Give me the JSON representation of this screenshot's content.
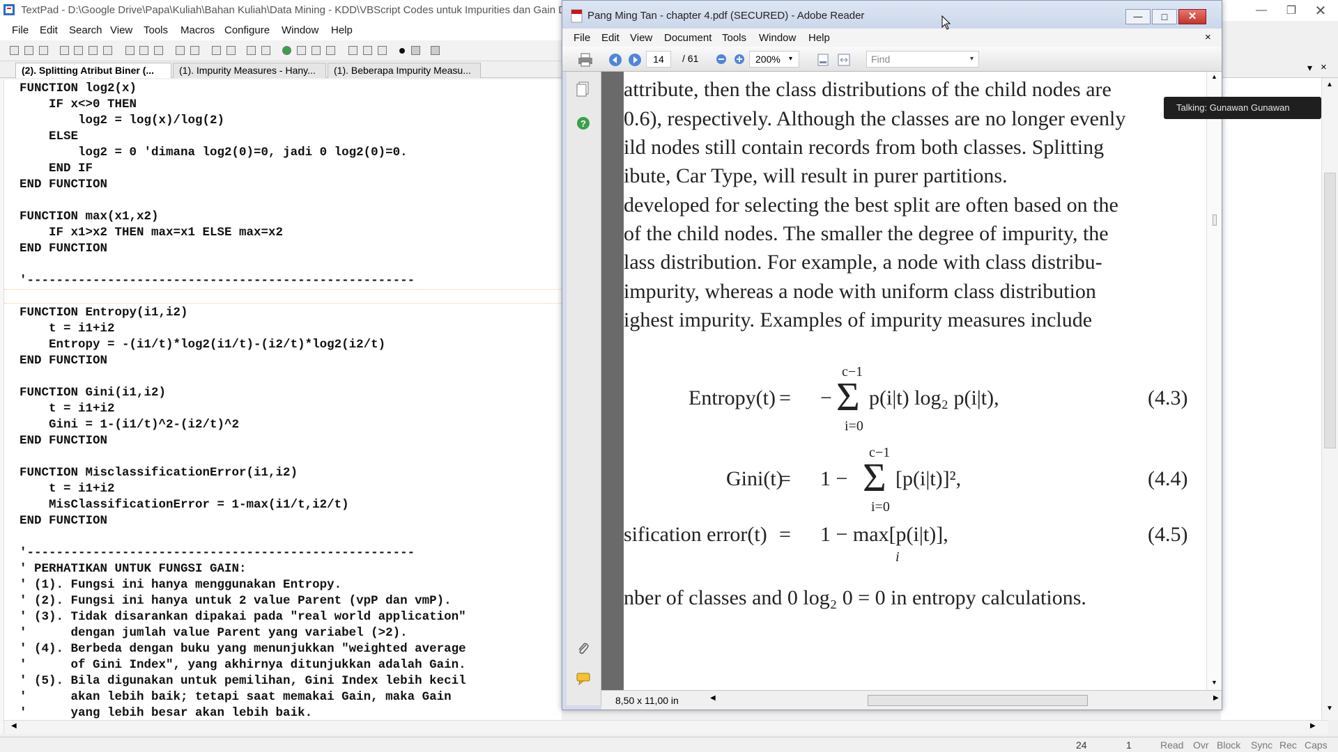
{
  "textpad": {
    "title": "TextPad - D:\\Google Drive\\Papa\\Kuliah\\Bahan Kuliah\\Data Mining - KDD\\VBScript Codes untuk Impurities dan Gain D",
    "menu": [
      "File",
      "Edit",
      "Search",
      "View",
      "Tools",
      "Macros",
      "Configure",
      "Window",
      "Help"
    ],
    "tabs": [
      "(2). Splitting Atribut Biner (...",
      "(1). Impurity Measures  - Hany...",
      "(1). Beberapa Impurity Measu..."
    ],
    "code_lines": [
      "FUNCTION log2(x)",
      "    IF x<>0 THEN",
      "        log2 = log(x)/log(2)",
      "    ELSE",
      "        log2 = 0 'dimana log2(0)=0, jadi 0 log2(0)=0.",
      "    END IF",
      "END FUNCTION",
      "",
      "FUNCTION max(x1,x2)",
      "    IF x1>x2 THEN max=x1 ELSE max=x2",
      "END FUNCTION",
      "",
      "'-----------------------------------------------------",
      "",
      "FUNCTION Entropy(i1,i2)",
      "    t = i1+i2",
      "    Entropy = -(i1/t)*log2(i1/t)-(i2/t)*log2(i2/t)",
      "END FUNCTION",
      "",
      "FUNCTION Gini(i1,i2)",
      "    t = i1+i2",
      "    Gini = 1-(i1/t)^2-(i2/t)^2",
      "END FUNCTION",
      "",
      "FUNCTION MisclassificationError(i1,i2)",
      "    t = i1+i2",
      "    MisClassificationError = 1-max(i1/t,i2/t)",
      "END FUNCTION",
      "",
      "'-----------------------------------------------------",
      "' PERHATIKAN UNTUK FUNGSI GAIN:",
      "' (1). Fungsi ini hanya menggunakan Entropy.",
      "' (2). Fungsi ini hanya untuk 2 value Parent (vpP dan vmP).",
      "' (3). Tidak disarankan dipakai pada \"real world application\"",
      "'      dengan jumlah value Parent yang variabel (>2).",
      "' (4). Berbeda dengan buku yang menunjukkan \"weighted average",
      "'      of Gini Index\", yang akhirnya ditunjukkan adalah Gain.",
      "' (5). Bila digunakan untuk pemilihan, Gini Index lebih kecil",
      "'      akan lebih baik; tetapi saat memakai Gain, maka Gain",
      "'      yang lebih besar akan lebih baik."
    ],
    "status": {
      "line": "24",
      "col": "1",
      "flags": [
        "Read",
        "Ovr",
        "Block",
        "Sync",
        "Rec",
        "Caps"
      ]
    }
  },
  "reader": {
    "title": "Pang Ming Tan - chapter 4.pdf (SECURED) - Adobe Reader",
    "menu": [
      "File",
      "Edit",
      "View",
      "Document",
      "Tools",
      "Window",
      "Help"
    ],
    "page_current": "14",
    "page_total": "/ 61",
    "zoom": "200%",
    "find_placeholder": "Find",
    "page_size": "8,50 x 11,00 in",
    "text_lines": [
      "attribute, then the class distributions of the child nodes are",
      "0.6), respectively. Although the classes are no longer evenly",
      "ild nodes still contain records from both classes. Splitting",
      "ibute, Car Type, will result in purer partitions.",
      "developed for selecting the best split are often based on the",
      " of the child nodes. The smaller the degree of impurity, the",
      "lass distribution. For example, a node with class distribu-",
      " impurity, whereas a node with uniform class distribution",
      "ighest impurity. Examples of impurity measures include"
    ],
    "eq_entropy_lhs": "Entropy(t)",
    "eq_entropy_rhs": "p(i|t) log₂ p(i|t),",
    "eq_entropy_num": "(4.3)",
    "eq_gini_lhs": "Gini(t)",
    "eq_gini_rhs": "[p(i|t)]²,",
    "eq_gini_num": "(4.4)",
    "eq_err_lhs": "sification error(t)",
    "eq_err_rhs": "1 − max[p(i|t)],",
    "eq_err_num": "(4.5)",
    "sum_top": "c−1",
    "sum_bottom": "i=0",
    "max_sub": "i",
    "eq_equals": "=",
    "eq_minus": "−",
    "eq_one_minus": "1 −",
    "footer_line": "nber of classes and 0 log₂ 0 = 0 in entropy calculations."
  },
  "tooltip": "Talking: Gunawan Gunawan",
  "icons": [
    "textpad-icon",
    "pdf-icon",
    "print-icon",
    "prev-page-icon",
    "next-page-icon",
    "zoom-out-icon",
    "zoom-in-icon",
    "pages-icon",
    "help-icon",
    "attachment-icon",
    "comment-icon",
    "minimize-icon",
    "maximize-icon",
    "close-icon"
  ]
}
